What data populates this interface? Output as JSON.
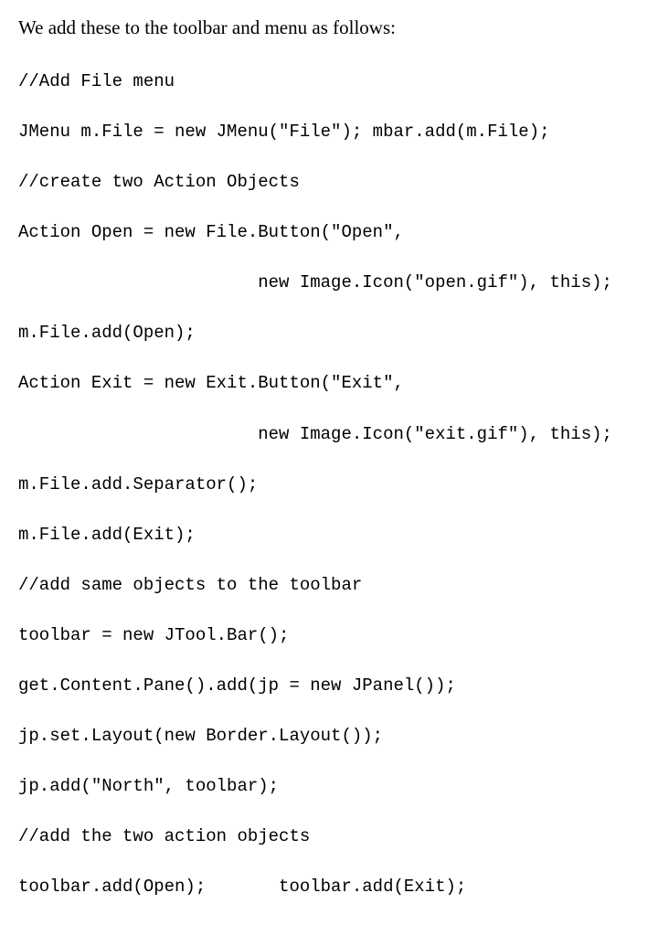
{
  "intro": "We add these to the toolbar and menu as follows:",
  "code": {
    "l01": "//Add File menu",
    "l02": "JMenu m.File = new JMenu(\"File\"); mbar.add(m.File);",
    "l03": "//create two Action Objects",
    "l04": "Action Open = new File.Button(\"Open\",",
    "l05": "                       new Image.Icon(\"open.gif\"), this);",
    "l06": "m.File.add(Open);",
    "l07": "Action Exit = new Exit.Button(\"Exit\",",
    "l08": "                       new Image.Icon(\"exit.gif\"), this);",
    "l09": "m.File.add.Separator();",
    "l10": "m.File.add(Exit);",
    "l11": "//add same objects to the toolbar",
    "l12": "toolbar = new JTool.Bar();",
    "l13": "get.Content.Pane().add(jp = new JPanel());",
    "l14": "jp.set.Layout(new Border.Layout());",
    "l15": "jp.add(\"North\", toolbar);",
    "l16": "//add the two action objects",
    "l17": "toolbar.add(Open);       toolbar.add(Exit);"
  }
}
